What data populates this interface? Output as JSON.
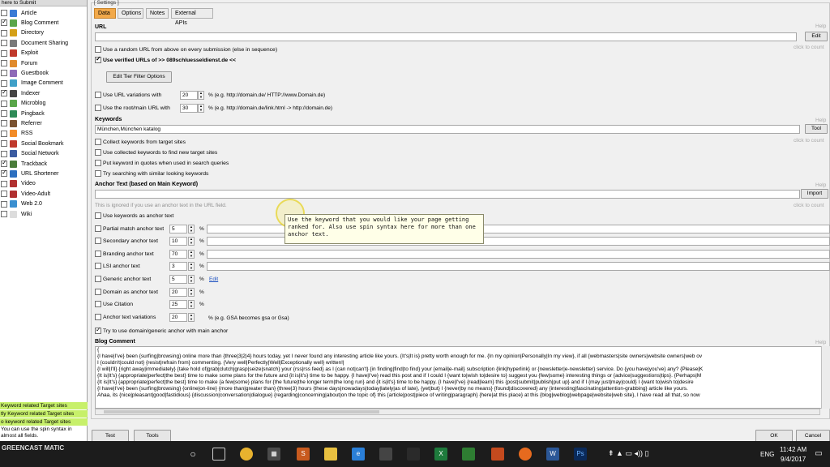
{
  "left_panel": {
    "header": "here to Submit",
    "items": [
      {
        "label": "Article",
        "checked": false,
        "color": "#3a7bd5"
      },
      {
        "label": "Blog Comment",
        "checked": true,
        "color": "#5aa64a"
      },
      {
        "label": "Directory",
        "checked": false,
        "color": "#d4a017"
      },
      {
        "label": "Document Sharing",
        "checked": false,
        "color": "#7a7a7a"
      },
      {
        "label": "Exploit",
        "checked": false,
        "color": "#c0392b"
      },
      {
        "label": "Forum",
        "checked": false,
        "color": "#e08a2c"
      },
      {
        "label": "Guestbook",
        "checked": false,
        "color": "#8e6bb8"
      },
      {
        "label": "Image Comment",
        "checked": false,
        "color": "#3fa0c8"
      },
      {
        "label": "Indexer",
        "checked": true,
        "color": "#444444"
      },
      {
        "label": "Microblog",
        "checked": false,
        "color": "#5aa64a"
      },
      {
        "label": "Pingback",
        "checked": false,
        "color": "#2e8b57"
      },
      {
        "label": "Referrer",
        "checked": false,
        "color": "#7a5230"
      },
      {
        "label": "RSS",
        "checked": false,
        "color": "#f28c28"
      },
      {
        "label": "Social Bookmark",
        "checked": false,
        "color": "#c0392b"
      },
      {
        "label": "Social Network",
        "checked": false,
        "color": "#3a5ba0"
      },
      {
        "label": "Trackback",
        "checked": true,
        "color": "#4a7c3a"
      },
      {
        "label": "URL Shortener",
        "checked": true,
        "color": "#2c6fbf"
      },
      {
        "label": "Video",
        "checked": false,
        "color": "#b03030"
      },
      {
        "label": "Video-Adult",
        "checked": false,
        "color": "#b03030"
      },
      {
        "label": "Web 2.0",
        "checked": false,
        "color": "#3a8fd0"
      },
      {
        "label": "Wiki",
        "checked": false,
        "color": "#dcdcdc"
      }
    ],
    "green_rows": [
      "Keyword related Target sites",
      "tly Keyword related Target sites",
      "o keyword related Target sites"
    ],
    "note": "You can use the spin syntax in almost all fields."
  },
  "settings_label": "[ Settings ]",
  "tabs": [
    {
      "label": "Data",
      "active": true
    },
    {
      "label": "Options",
      "active": false
    },
    {
      "label": "Notes",
      "active": false
    },
    {
      "label": "External APIs",
      "active": false
    }
  ],
  "help": "Help",
  "click_to_count": "click to count",
  "url": {
    "title": "URL",
    "value": "",
    "edit": "Edit",
    "random_url": "Use a random URL from above on every submission (else in sequence)",
    "verified_urls": "Use verified URLs of >> 089schluesseldienst.de <<",
    "tier_filter": "Edit Tier Filter Options",
    "url_variations": "Use URL variations with",
    "url_variations_value": "20",
    "url_variations_hint": "% (e.g. http://domain.de/ HTTP://www.Domain.de)",
    "root_url": "Use the root/main URL with",
    "root_url_value": "30",
    "root_url_hint": "% (e.g. http://domain.de/link.html -> http://domain.de)"
  },
  "keywords": {
    "title": "Keywords",
    "value": "München,München katalog",
    "tool": "Tool",
    "options": [
      "Collect keywords from target sites",
      "Use collected keywords to find new target sites",
      "Put keyword in quotes when used in search queries",
      "Try searching with similar looking keywords"
    ]
  },
  "anchor": {
    "title": "Anchor Text (based on Main Keyword)",
    "import": "Import",
    "ignored_note": "This is ignored if you use an anchor text in the URL field.",
    "use_keywords": "Use keywords as anchor text",
    "rows": [
      {
        "label": "Partial match anchor text",
        "value": "5"
      },
      {
        "label": "Secondary anchor text",
        "value": "10"
      },
      {
        "label": "Branding anchor text",
        "value": "70"
      },
      {
        "label": "LSI anchor text",
        "value": "3"
      },
      {
        "label": "Generic anchor text",
        "value": "5"
      },
      {
        "label": "Domain as anchor text",
        "value": "20"
      },
      {
        "label": "Use Citation",
        "value": "25"
      },
      {
        "label": "Anchor text variations",
        "value": "20"
      }
    ],
    "percent": "%",
    "edit_link": "Edit",
    "variations_hint": "% (e.g. GSA becomes gsa or Gsa)",
    "try_domain": "Try to use domain/generic anchor with main anchor"
  },
  "tooltip": "Use the keyword that you would like your page getting ranked for. Also use spin syntax here for more than one anchor text.",
  "blog_comment": {
    "title": "Blog Comment",
    "lines": [
      "{",
      "{I have|I've} been {surfing|browsing} online more than {three|3|2|4} hours today, yet I never found any interesting article like yours. {It's|It is} pretty worth enough for me. {In my opinion|Personally|In my view}, if all {webmasters|site owners|website owners|web ov",
      "I {couldn't|could not} {resist|refrain from} commenting. {Very well|Perfectly|Well|Exceptionally well} written!|",
      "{I will|I'll} {right away|immediately} {take hold of|grab|clutch|grasp|seize|snatch} your {rss|rss feed} as I {can not|can't} {in finding|find|to find} your {email|e-mail} subscription {link|hyperlink} or {newsletter|e-newsletter} service. Do {you have|you've} any? {Please|K",
      "{It is|It's} {appropriate|perfect|the best} time to make some plans for the future and {it is|it's} time to be happy. {I have|I've} read this post and if I could I {want to|wish to|desire to} suggest you {few|some} interesting things or {advice|suggestions|tips}. {Perhaps|M",
      "{It is|It's} {appropriate|perfect|the best} time to make {a few|some} plans for {the future|the longer term|the long run} and {it is|it's} time to be happy. {I have|I've} {read|learn} this {post|submit|publish|put up} and if I {may just|may|could} I {want to|wish to|desire",
      "{I have|I've} been {surfing|browsing} {online|on-line} {more than|greater than} {three|3} hours {these days|nowadays|today|lately|as of late}, {yet|but} I {never|by no means} {found|discovered} any {interesting|fascinating|attention-grabbing} article like yours.",
      "Ahaa, its {nice|pleasant|good|fastidious} {discussion|conversation|dialogue} {regarding|concerning|about|on the topic of} this {article|post|piece of writing|paragraph} {here|at this place} at this {blog|weblog|webpage|website|web site}, I have read all that, so now"
    ]
  },
  "buttons": {
    "test": "Test",
    "tools": "Tools",
    "ok": "OK",
    "cancel": "Cancel"
  },
  "taskbar": {
    "watermark": "GREENCAST   MATIC",
    "lang": "ENG",
    "time": "11:42 AM",
    "date": "9/4/2017"
  }
}
